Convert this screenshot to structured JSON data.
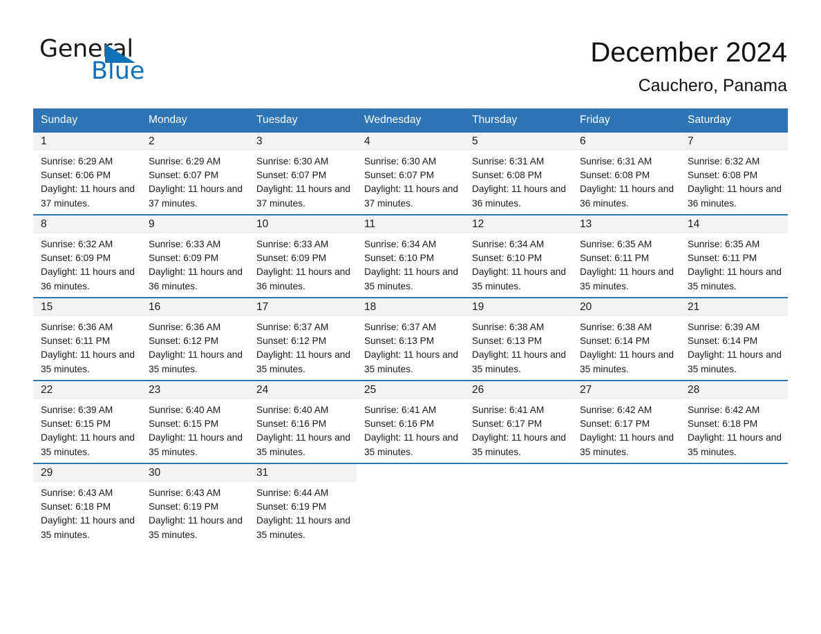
{
  "brand": {
    "name_part1": "General",
    "name_part2": "Blue",
    "triangle_color": "#1270b8"
  },
  "header": {
    "title": "December 2024",
    "subtitle": "Cauchero, Panama"
  },
  "theme": {
    "header_blue": "#2e75b6",
    "daynum_band": "#f2f2f2",
    "text": "#1a1a1a",
    "page_background": "#ffffff"
  },
  "calendar": {
    "weekday_headers": [
      "Sunday",
      "Monday",
      "Tuesday",
      "Wednesday",
      "Thursday",
      "Friday",
      "Saturday"
    ],
    "weeks": [
      [
        {
          "day": "1",
          "sunrise": "Sunrise: 6:29 AM",
          "sunset": "Sunset: 6:06 PM",
          "daylight": "Daylight: 11 hours and 37 minutes."
        },
        {
          "day": "2",
          "sunrise": "Sunrise: 6:29 AM",
          "sunset": "Sunset: 6:07 PM",
          "daylight": "Daylight: 11 hours and 37 minutes."
        },
        {
          "day": "3",
          "sunrise": "Sunrise: 6:30 AM",
          "sunset": "Sunset: 6:07 PM",
          "daylight": "Daylight: 11 hours and 37 minutes."
        },
        {
          "day": "4",
          "sunrise": "Sunrise: 6:30 AM",
          "sunset": "Sunset: 6:07 PM",
          "daylight": "Daylight: 11 hours and 37 minutes."
        },
        {
          "day": "5",
          "sunrise": "Sunrise: 6:31 AM",
          "sunset": "Sunset: 6:08 PM",
          "daylight": "Daylight: 11 hours and 36 minutes."
        },
        {
          "day": "6",
          "sunrise": "Sunrise: 6:31 AM",
          "sunset": "Sunset: 6:08 PM",
          "daylight": "Daylight: 11 hours and 36 minutes."
        },
        {
          "day": "7",
          "sunrise": "Sunrise: 6:32 AM",
          "sunset": "Sunset: 6:08 PM",
          "daylight": "Daylight: 11 hours and 36 minutes."
        }
      ],
      [
        {
          "day": "8",
          "sunrise": "Sunrise: 6:32 AM",
          "sunset": "Sunset: 6:09 PM",
          "daylight": "Daylight: 11 hours and 36 minutes."
        },
        {
          "day": "9",
          "sunrise": "Sunrise: 6:33 AM",
          "sunset": "Sunset: 6:09 PM",
          "daylight": "Daylight: 11 hours and 36 minutes."
        },
        {
          "day": "10",
          "sunrise": "Sunrise: 6:33 AM",
          "sunset": "Sunset: 6:09 PM",
          "daylight": "Daylight: 11 hours and 36 minutes."
        },
        {
          "day": "11",
          "sunrise": "Sunrise: 6:34 AM",
          "sunset": "Sunset: 6:10 PM",
          "daylight": "Daylight: 11 hours and 35 minutes."
        },
        {
          "day": "12",
          "sunrise": "Sunrise: 6:34 AM",
          "sunset": "Sunset: 6:10 PM",
          "daylight": "Daylight: 11 hours and 35 minutes."
        },
        {
          "day": "13",
          "sunrise": "Sunrise: 6:35 AM",
          "sunset": "Sunset: 6:11 PM",
          "daylight": "Daylight: 11 hours and 35 minutes."
        },
        {
          "day": "14",
          "sunrise": "Sunrise: 6:35 AM",
          "sunset": "Sunset: 6:11 PM",
          "daylight": "Daylight: 11 hours and 35 minutes."
        }
      ],
      [
        {
          "day": "15",
          "sunrise": "Sunrise: 6:36 AM",
          "sunset": "Sunset: 6:11 PM",
          "daylight": "Daylight: 11 hours and 35 minutes."
        },
        {
          "day": "16",
          "sunrise": "Sunrise: 6:36 AM",
          "sunset": "Sunset: 6:12 PM",
          "daylight": "Daylight: 11 hours and 35 minutes."
        },
        {
          "day": "17",
          "sunrise": "Sunrise: 6:37 AM",
          "sunset": "Sunset: 6:12 PM",
          "daylight": "Daylight: 11 hours and 35 minutes."
        },
        {
          "day": "18",
          "sunrise": "Sunrise: 6:37 AM",
          "sunset": "Sunset: 6:13 PM",
          "daylight": "Daylight: 11 hours and 35 minutes."
        },
        {
          "day": "19",
          "sunrise": "Sunrise: 6:38 AM",
          "sunset": "Sunset: 6:13 PM",
          "daylight": "Daylight: 11 hours and 35 minutes."
        },
        {
          "day": "20",
          "sunrise": "Sunrise: 6:38 AM",
          "sunset": "Sunset: 6:14 PM",
          "daylight": "Daylight: 11 hours and 35 minutes."
        },
        {
          "day": "21",
          "sunrise": "Sunrise: 6:39 AM",
          "sunset": "Sunset: 6:14 PM",
          "daylight": "Daylight: 11 hours and 35 minutes."
        }
      ],
      [
        {
          "day": "22",
          "sunrise": "Sunrise: 6:39 AM",
          "sunset": "Sunset: 6:15 PM",
          "daylight": "Daylight: 11 hours and 35 minutes."
        },
        {
          "day": "23",
          "sunrise": "Sunrise: 6:40 AM",
          "sunset": "Sunset: 6:15 PM",
          "daylight": "Daylight: 11 hours and 35 minutes."
        },
        {
          "day": "24",
          "sunrise": "Sunrise: 6:40 AM",
          "sunset": "Sunset: 6:16 PM",
          "daylight": "Daylight: 11 hours and 35 minutes."
        },
        {
          "day": "25",
          "sunrise": "Sunrise: 6:41 AM",
          "sunset": "Sunset: 6:16 PM",
          "daylight": "Daylight: 11 hours and 35 minutes."
        },
        {
          "day": "26",
          "sunrise": "Sunrise: 6:41 AM",
          "sunset": "Sunset: 6:17 PM",
          "daylight": "Daylight: 11 hours and 35 minutes."
        },
        {
          "day": "27",
          "sunrise": "Sunrise: 6:42 AM",
          "sunset": "Sunset: 6:17 PM",
          "daylight": "Daylight: 11 hours and 35 minutes."
        },
        {
          "day": "28",
          "sunrise": "Sunrise: 6:42 AM",
          "sunset": "Sunset: 6:18 PM",
          "daylight": "Daylight: 11 hours and 35 minutes."
        }
      ],
      [
        {
          "day": "29",
          "sunrise": "Sunrise: 6:43 AM",
          "sunset": "Sunset: 6:18 PM",
          "daylight": "Daylight: 11 hours and 35 minutes."
        },
        {
          "day": "30",
          "sunrise": "Sunrise: 6:43 AM",
          "sunset": "Sunset: 6:19 PM",
          "daylight": "Daylight: 11 hours and 35 minutes."
        },
        {
          "day": "31",
          "sunrise": "Sunrise: 6:44 AM",
          "sunset": "Sunset: 6:19 PM",
          "daylight": "Daylight: 11 hours and 35 minutes."
        },
        {
          "day": "",
          "sunrise": "",
          "sunset": "",
          "daylight": ""
        },
        {
          "day": "",
          "sunrise": "",
          "sunset": "",
          "daylight": ""
        },
        {
          "day": "",
          "sunrise": "",
          "sunset": "",
          "daylight": ""
        },
        {
          "day": "",
          "sunrise": "",
          "sunset": "",
          "daylight": ""
        }
      ]
    ]
  }
}
